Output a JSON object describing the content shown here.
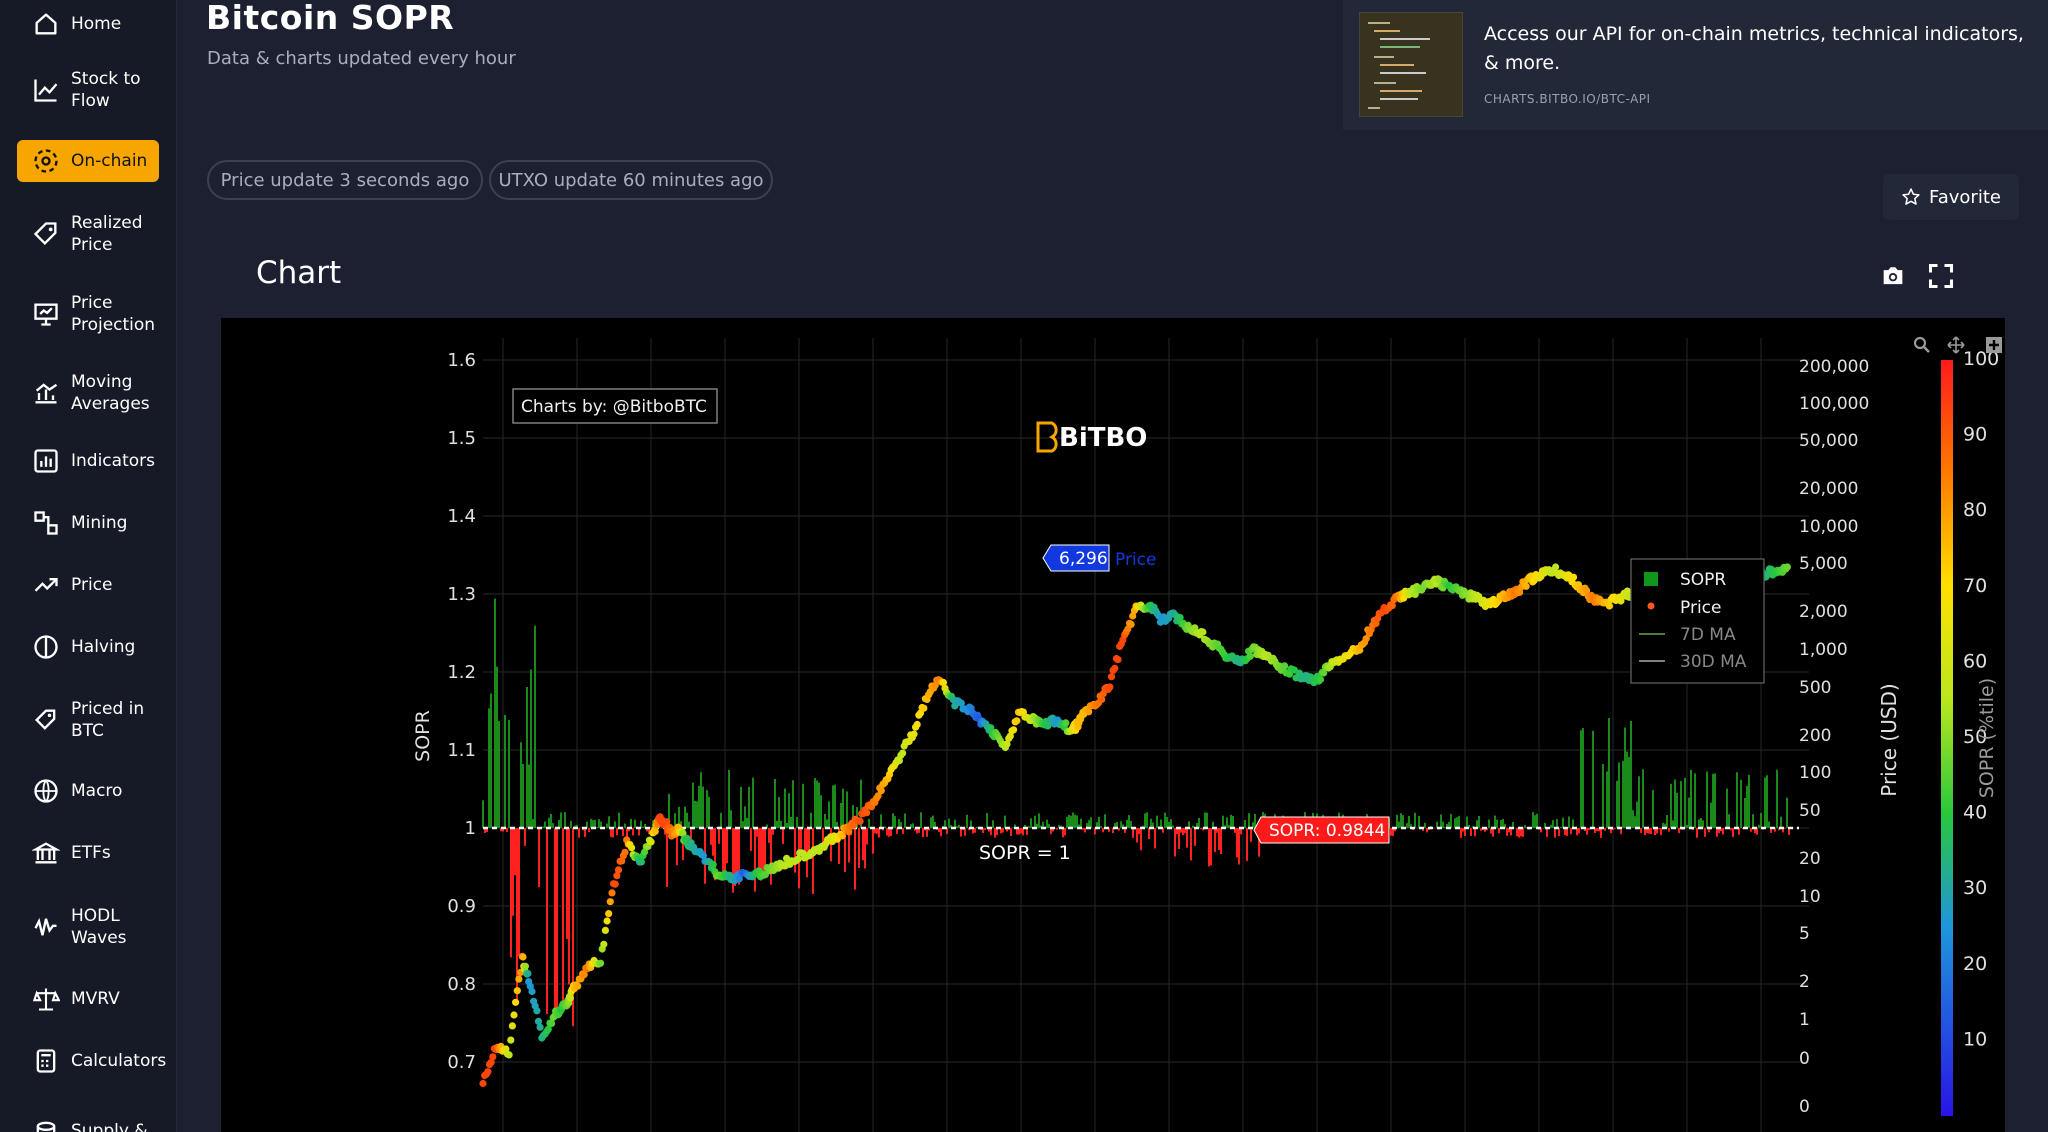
{
  "sidebar": {
    "items": [
      {
        "label": "Home",
        "icon": "home-icon"
      },
      {
        "label": "Stock to Flow",
        "icon": "line-chart-icon"
      },
      {
        "label": "On-chain",
        "icon": "network-icon",
        "active": true
      },
      {
        "label": "Realized Price",
        "icon": "tag-icon"
      },
      {
        "label": "Price Projection",
        "icon": "presentation-icon"
      },
      {
        "label": "Moving Averages",
        "icon": "moving-average-icon"
      },
      {
        "label": "Indicators",
        "icon": "bar-chart-icon"
      },
      {
        "label": "Mining",
        "icon": "mining-icon"
      },
      {
        "label": "Price",
        "icon": "trend-up-icon"
      },
      {
        "label": "Halving",
        "icon": "halving-icon"
      },
      {
        "label": "Priced in BTC",
        "icon": "price-tag-icon"
      },
      {
        "label": "Macro",
        "icon": "globe-icon"
      },
      {
        "label": "ETFs",
        "icon": "bank-icon"
      },
      {
        "label": "HODL Waves",
        "icon": "wave-icon"
      },
      {
        "label": "MVRV",
        "icon": "scale-icon"
      },
      {
        "label": "Calculators",
        "icon": "calculator-icon"
      },
      {
        "label": "Supply &",
        "icon": "coins-icon"
      }
    ]
  },
  "header": {
    "title": "Bitcoin SOPR",
    "subtitle": "Data & charts updated every hour"
  },
  "api_card": {
    "text": "Access our API for on-chain metrics, technical indicators, & more.",
    "link": "CHARTS.BITBO.IO/BTC-API"
  },
  "status": {
    "price_update": "Price update 3 seconds ago",
    "utxo_update": "UTXO update 60 minutes ago"
  },
  "favorite_label": "Favorite",
  "chart_section": {
    "heading": "Chart",
    "toolbar": [
      "zoom-icon",
      "pan-icon",
      "zoom-in-icon",
      "zoom-out-icon",
      "autoscale-icon",
      "reset-axes-icon"
    ]
  },
  "chart_data": {
    "type": "bar",
    "title": "",
    "watermark": "Charts by: @BitboBTC",
    "logo_text": "BiTBO",
    "ylabel_left": "SOPR",
    "ylabel_right": "Price (USD)",
    "colorbar_label": "SOPR (%tile)",
    "sopr_ticks": [
      "1.6",
      "1.5",
      "1.4",
      "1.3",
      "1.2",
      "1.1",
      "1",
      "0.9",
      "0.8",
      "0.7"
    ],
    "sopr_tick_values": [
      1.6,
      1.5,
      1.4,
      1.3,
      1.2,
      1.1,
      1.0,
      0.9,
      0.8,
      0.7
    ],
    "ylim_sopr": [
      0.66,
      1.64
    ],
    "price_ticks": [
      "200,000",
      "100,000",
      "50,000",
      "20,000",
      "10,000",
      "5,000",
      "2,000",
      "1,000",
      "500",
      "200",
      "100",
      "50",
      "20",
      "10",
      "5",
      "2",
      "1",
      "0",
      "0"
    ],
    "colorbar_ticks": [
      "100",
      "90",
      "80",
      "70",
      "60",
      "50",
      "40",
      "30",
      "20",
      "10"
    ],
    "colorbar_tick_values": [
      100,
      90,
      80,
      70,
      60,
      50,
      40,
      30,
      20,
      10
    ],
    "reference_line": {
      "value": 1,
      "label": "SOPR = 1"
    },
    "hover": {
      "price_value": "6,296",
      "price_name": "Price",
      "sopr_label": "SOPR: 0.9844"
    },
    "legend": {
      "placement": "right",
      "items": [
        {
          "name": "SOPR",
          "color": "#109618"
        },
        {
          "name": "Price",
          "color": "#ff5722"
        },
        {
          "name": "7D MA",
          "color": "#6aa84f"
        },
        {
          "name": "30D MA",
          "color": "#aaaaaa"
        }
      ]
    },
    "series": [
      {
        "name": "Price",
        "x_fraction": [
          0.0,
          0.01,
          0.02,
          0.03,
          0.035,
          0.045,
          0.055,
          0.06,
          0.065,
          0.07,
          0.08,
          0.09,
          0.1,
          0.11,
          0.12,
          0.13,
          0.135,
          0.14,
          0.145,
          0.15,
          0.155,
          0.16,
          0.17,
          0.18,
          0.19,
          0.2,
          0.21,
          0.22,
          0.23,
          0.24,
          0.25,
          0.26,
          0.27,
          0.28,
          0.29,
          0.3,
          0.31,
          0.32,
          0.33,
          0.34,
          0.35,
          0.36,
          0.37,
          0.38,
          0.39,
          0.4,
          0.41,
          0.42,
          0.43,
          0.44,
          0.45,
          0.455,
          0.46,
          0.47,
          0.48,
          0.49,
          0.5,
          0.51,
          0.52,
          0.53,
          0.54,
          0.55,
          0.56,
          0.57,
          0.58,
          0.59,
          0.6,
          0.61,
          0.62,
          0.63,
          0.64,
          0.65,
          0.66,
          0.67,
          0.68,
          0.69,
          0.7,
          0.71,
          0.72,
          0.73,
          0.74,
          0.75,
          0.76,
          0.77,
          0.78,
          0.79,
          0.8,
          0.81,
          0.82,
          0.83,
          0.84,
          0.85,
          0.86,
          0.87,
          0.88,
          0.89,
          0.9,
          0.91,
          0.92,
          0.93,
          0.94,
          0.95,
          0.96,
          0.97,
          0.98,
          0.99,
          1.0
        ],
        "y_percent": [
          2,
          14,
          12,
          45,
          38,
          18,
          25,
          28,
          30,
          35,
          42,
          44,
          70,
          85,
          78,
          88,
          93,
          92,
          88,
          90,
          86,
          84,
          80,
          74,
          73,
          74,
          74,
          76,
          78,
          80,
          82,
          84,
          87,
          90,
          94,
          100,
          108,
          116,
          124,
          136,
          142,
          134,
          132,
          128,
          124,
          118,
          130,
          128,
          126,
          128,
          124,
          126,
          130,
          134,
          140,
          156,
          166,
          168,
          162,
          164,
          160,
          158,
          154,
          150,
          148,
          152,
          150,
          146,
          144,
          142,
          142,
          148,
          150,
          152,
          160,
          166,
          170,
          172,
          174,
          176,
          174,
          172,
          170,
          168,
          170,
          172,
          176,
          178,
          180,
          178,
          174,
          170,
          168,
          170,
          172,
          174,
          174,
          172,
          170,
          168,
          170,
          172,
          174,
          176,
          178,
          180,
          180
        ],
        "sopr_pct": [
          95,
          95,
          60,
          90,
          20,
          30,
          50,
          40,
          50,
          80,
          90,
          50,
          95,
          90,
          30,
          70,
          95,
          95,
          90,
          80,
          40,
          30,
          20,
          50,
          30,
          10,
          40,
          50,
          60,
          60,
          60,
          60,
          70,
          90,
          95,
          90,
          80,
          60,
          70,
          80,
          90,
          30,
          20,
          10,
          40,
          60,
          80,
          60,
          40,
          20,
          60,
          80,
          80,
          90,
          95,
          95,
          80,
          40,
          20,
          30,
          50,
          60,
          50,
          40,
          30,
          50,
          60,
          50,
          40,
          30,
          40,
          60,
          70,
          80,
          90,
          95,
          90,
          60,
          50,
          60,
          40,
          50,
          60,
          70,
          80,
          90,
          80,
          70,
          60,
          70,
          80,
          90,
          80,
          70,
          60,
          70,
          80,
          90,
          90,
          80,
          70,
          60,
          40,
          20,
          30,
          40,
          50
        ]
      }
    ]
  }
}
